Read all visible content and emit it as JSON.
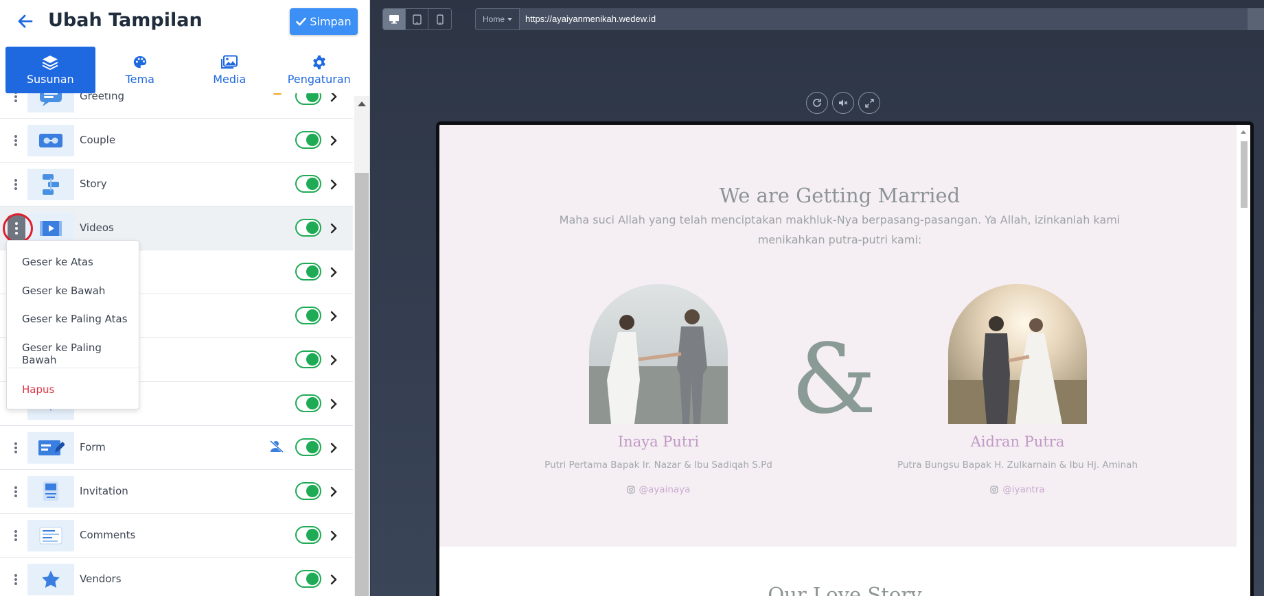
{
  "header": {
    "title": "Ubah Tampilan",
    "save_label": "Simpan"
  },
  "tabs": [
    {
      "label": "Susunan",
      "icon": "layers-icon",
      "active": true
    },
    {
      "label": "Tema",
      "icon": "palette-icon",
      "active": false
    },
    {
      "label": "Media",
      "icon": "images-icon",
      "active": false
    },
    {
      "label": "Pengaturan",
      "icon": "gear-icon",
      "active": false
    }
  ],
  "sections": [
    {
      "label": "Greeting",
      "enabled": true
    },
    {
      "label": "Couple",
      "enabled": true
    },
    {
      "label": "Story",
      "enabled": true
    },
    {
      "label": "Videos",
      "enabled": true
    },
    {
      "label": "",
      "enabled": true
    },
    {
      "label": "",
      "enabled": true
    },
    {
      "label": "",
      "enabled": true
    },
    {
      "label": "",
      "enabled": true
    },
    {
      "label": "Form",
      "enabled": true
    },
    {
      "label": "Invitation",
      "enabled": true
    },
    {
      "label": "Comments",
      "enabled": true
    },
    {
      "label": "Vendors",
      "enabled": true
    }
  ],
  "context_menu": {
    "items": [
      "Geser ke Atas",
      "Geser ke Bawah",
      "Geser ke Paling Atas",
      "Geser ke Paling Bawah"
    ],
    "delete_label": "Hapus"
  },
  "preview": {
    "page_select": "Home",
    "url": "https://ayaiyanmenikah.wedew.id",
    "heading": "We are Getting Married",
    "intro": "Maha suci Allah yang telah menciptakan makhluk-Nya berpasang-pasangan. Ya Allah, izinkanlah kami menikahkan putra-putri kami:",
    "ampersand": "&",
    "bride": {
      "name": "Inaya Putri",
      "desc": "Putri Pertama Bapak Ir. Nazar & Ibu Sadiqah S.Pd",
      "instagram": "@ayainaya"
    },
    "groom": {
      "name": "Aidran Putra",
      "desc": "Putra Bungsu Bapak H. Zulkarnain & Ibu Hj. Aminah",
      "instagram": "@iyantra"
    },
    "section2_heading": "Our Love Story"
  },
  "colors": {
    "primary": "#1e68e0",
    "save_button": "#3b8ff5",
    "toggle_on": "#1faa55",
    "danger": "#dc3545",
    "highlight_ring": "#e21d2c",
    "preview_bg": "#f5eff3",
    "name_color": "#c199c5"
  }
}
